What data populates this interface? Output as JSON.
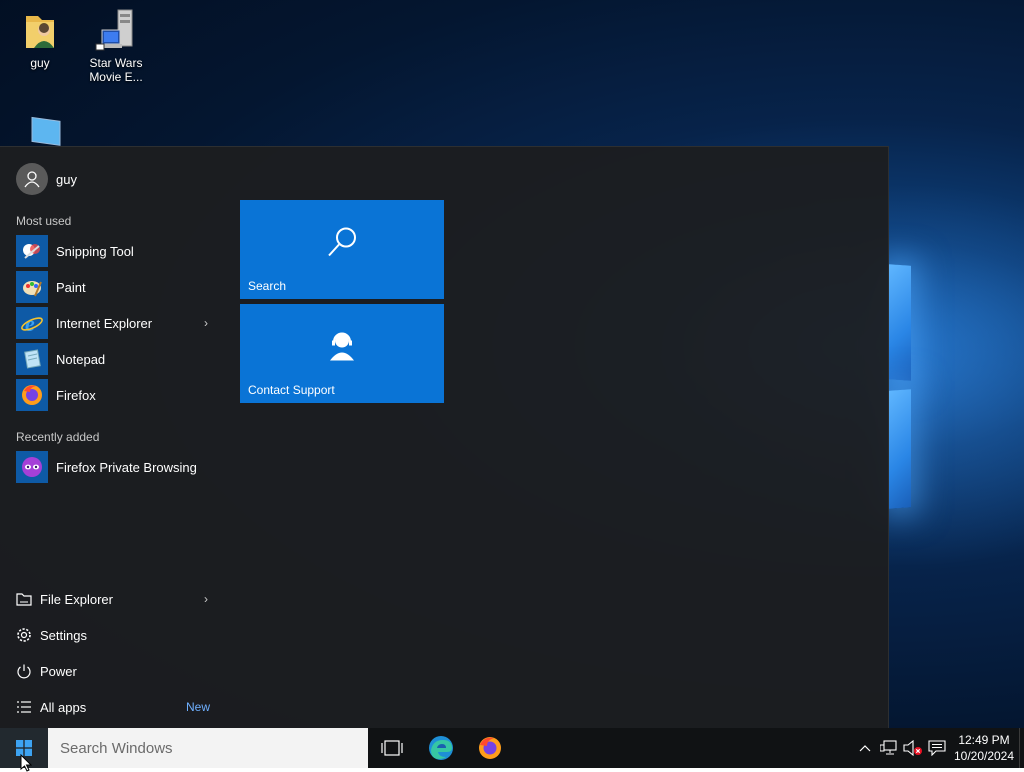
{
  "desktop": {
    "icons": [
      {
        "label": "guy",
        "icon": "user-folder-icon"
      },
      {
        "label": "Star Wars Movie E...",
        "icon": "network-computer-icon"
      },
      {
        "label": "",
        "icon": "this-pc-icon"
      }
    ]
  },
  "start_menu": {
    "user": {
      "name": "guy",
      "icon": "user-avatar-icon"
    },
    "most_used_label": "Most used",
    "most_used": [
      {
        "label": "Snipping Tool",
        "icon": "snipping-tool-icon",
        "has_submenu": false
      },
      {
        "label": "Paint",
        "icon": "paint-icon",
        "has_submenu": false
      },
      {
        "label": "Internet Explorer",
        "icon": "internet-explorer-icon",
        "has_submenu": true
      },
      {
        "label": "Notepad",
        "icon": "notepad-icon",
        "has_submenu": false
      },
      {
        "label": "Firefox",
        "icon": "firefox-icon",
        "has_submenu": false
      }
    ],
    "recently_added_label": "Recently added",
    "recently_added": [
      {
        "label": "Firefox Private Browsing",
        "icon": "firefox-private-icon"
      }
    ],
    "system": [
      {
        "label": "File Explorer",
        "icon": "file-explorer-icon",
        "has_submenu": true
      },
      {
        "label": "Settings",
        "icon": "gear-icon",
        "has_submenu": false
      },
      {
        "label": "Power",
        "icon": "power-icon",
        "has_submenu": false
      },
      {
        "label": "All apps",
        "icon": "list-icon",
        "badge": "New"
      }
    ],
    "tiles": [
      {
        "label": "Search",
        "icon": "search-icon"
      },
      {
        "label": "Contact Support",
        "icon": "support-agent-icon"
      }
    ],
    "tile_color": "#0a74d6"
  },
  "taskbar": {
    "search_placeholder": "Search Windows",
    "pinned": [
      {
        "name": "Task View",
        "icon": "task-view-icon"
      },
      {
        "name": "Microsoft Edge",
        "icon": "edge-icon"
      },
      {
        "name": "Firefox",
        "icon": "firefox-icon"
      }
    ],
    "tray_icons": [
      "chevron-up-icon",
      "network-icon",
      "volume-muted-icon",
      "notification-icon"
    ],
    "time": "12:49 PM",
    "date": "10/20/2024"
  }
}
